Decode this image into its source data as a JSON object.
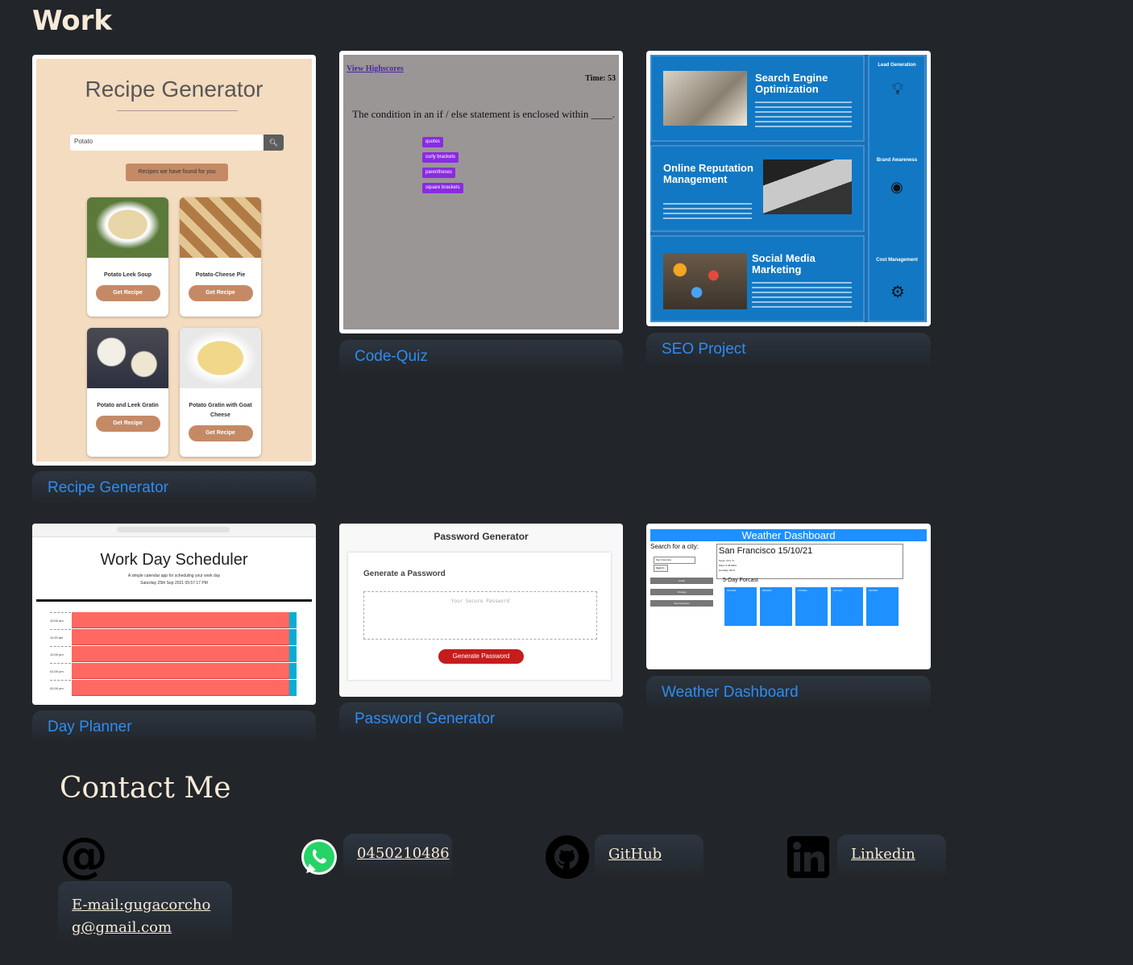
{
  "section_title": "Work",
  "projects": [
    {
      "label": "Recipe Generator"
    },
    {
      "label": "Code-Quiz"
    },
    {
      "label": "SEO Project"
    },
    {
      "label": "Day Planner"
    },
    {
      "label": "Password Generator"
    },
    {
      "label": "Weather Dashboard"
    }
  ],
  "recipe": {
    "title": "Recipe Generator",
    "search_value": "Potato",
    "found_label": "Recipes we have found for you",
    "cards": [
      "Potato Leek Soup",
      "Potato-Cheese Pie",
      "Potato and Leek Gratin",
      "Potato Gratin with Goat Cheese"
    ],
    "button": "Get Recipe"
  },
  "quiz": {
    "highscores": "View Highscores",
    "time": "Time: 53",
    "question": "The condition in an if / else statement is enclosed within ____.",
    "options": [
      "quotes",
      "curly brackets",
      "parentheses",
      "square brackets"
    ]
  },
  "seo": {
    "sections": [
      "Search Engine Optimization",
      "Online Reputation Management",
      "Social Media Marketing"
    ],
    "side": [
      "Lead Generation",
      "Brand Awareness",
      "Cost Management"
    ]
  },
  "planner": {
    "title": "Work Day Scheduler",
    "subtitle": "A simple calendar app for scheduling your work day",
    "date": "Saturday 25th Sep 2021 05:57:17 PM",
    "hours": [
      "10:00 am",
      "11:00 am",
      "12:00 pm",
      "01:00 pm",
      "02:00 pm"
    ]
  },
  "password": {
    "title": "Password Generator",
    "subtitle": "Generate a Password",
    "placeholder": "Your Secure Password",
    "button": "Generate Password"
  },
  "weather": {
    "title": "Weather Dashboard",
    "search_label": "Search for a city:",
    "search_value": "San Francisco",
    "search_button": "Search",
    "cities": [
      "Austin",
      "Chicago",
      "San Francisco"
    ],
    "current": "San Francisco 15/10/21",
    "current_details": [
      "Temp: 13.5 °C",
      "Wind: 0.45 MPH",
      "Humidity: 86 %"
    ],
    "forecast_label": "5-Day Forcast",
    "forecast_dates": [
      "15/10/21",
      "16/10/21",
      "17/10/21",
      "18/10/21",
      "19/10/21"
    ]
  },
  "contact": {
    "title": "Contact Me",
    "email": "E-mail:gugacorchog@gmail.com",
    "phone": "0450210486",
    "github": "GitHub",
    "linkedin": "Linkedin"
  },
  "colors": {
    "background": "#222529",
    "accent": "#2f8cf0",
    "title": "#f7ead8"
  }
}
